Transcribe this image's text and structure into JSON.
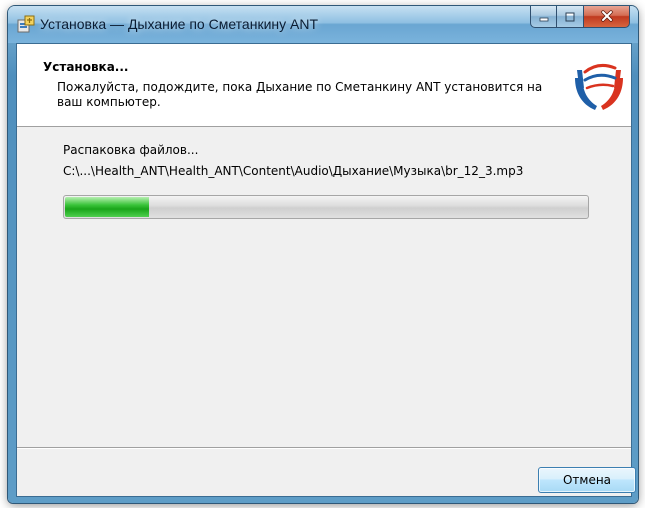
{
  "window": {
    "title": "Установка — Дыхание по Сметанкину ANT",
    "app_icon": "installer-icon",
    "caption_buttons": {
      "minimize_icon": "minimize-icon",
      "maximize_icon": "maximize-icon",
      "close_icon": "close-icon"
    }
  },
  "header": {
    "title": "Установка...",
    "description": "Пожалуйста, подождите, пока Дыхание по Сметанкину ANT установится на ваш компьютер.",
    "logo": "hands-logo-icon"
  },
  "main": {
    "status_label": "Распаковка файлов...",
    "current_file": "C:\\...\\Health_ANT\\Health_ANT\\Content\\Audio\\Дыхание\\Музыка\\br_12_3.mp3",
    "progress": 0.16
  },
  "footer": {
    "cancel_label": "Отмена"
  },
  "colors": {
    "progress_fill": "#1aa51a",
    "dialog_background": "#f0f0f0",
    "header_background": "#ffffff",
    "logo_blue": "#1f5fa8",
    "logo_red": "#d9331f"
  }
}
